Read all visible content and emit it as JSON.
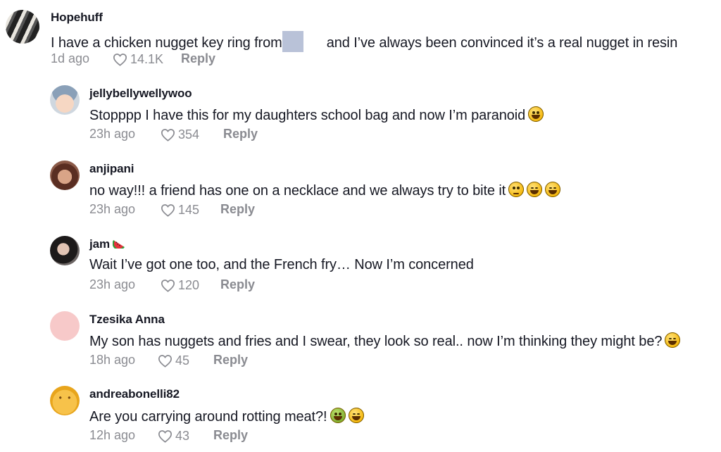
{
  "comments": [
    {
      "username": "Hopehuff",
      "text_before": "I have a chicken nugget key ring from",
      "text_after": "and I’ve always been convinced it’s a real nugget in resin",
      "time": "1d ago",
      "likes": "14.1K",
      "reply": "Reply"
    },
    {
      "username": "jellybellywellywoo",
      "text": "Stopppp I have this for my daughters school bag and now I’m paranoid",
      "time": "23h ago",
      "likes": "354",
      "reply": "Reply"
    },
    {
      "username": "anjipani",
      "text": "no way!!! a friend has one on a necklace and we always try to bite it",
      "time": "23h ago",
      "likes": "145",
      "reply": "Reply"
    },
    {
      "username": "jam",
      "text": "Wait I’ve got one too, and the French fry… Now I’m concerned",
      "time": "23h ago",
      "likes": "120",
      "reply": "Reply"
    },
    {
      "username": "Tzesika Anna",
      "text": "My son has nuggets and fries and I swear, they look so real.. now I’m thinking they might be?",
      "time": "18h ago",
      "likes": "45",
      "reply": "Reply"
    },
    {
      "username": "andreabonelli82",
      "text": "Are you carrying around rotting meat?!",
      "time": "12h ago",
      "likes": "43",
      "reply": "Reply"
    }
  ]
}
